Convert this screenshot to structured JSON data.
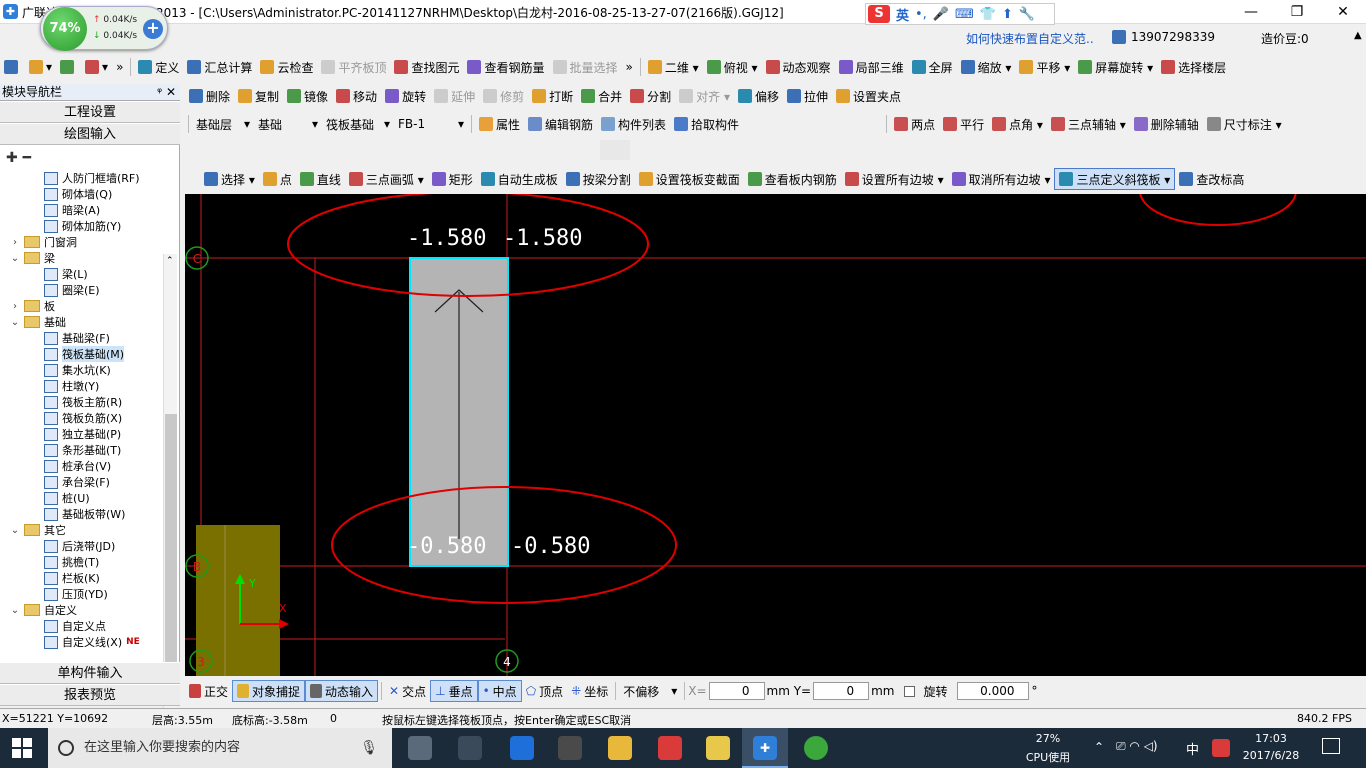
{
  "window": {
    "title": "广联达钢筋算量软件 GGJ2013 - [C:\\Users\\Administrator.PC-20141127NRHM\\Desktop\\白龙村-2016-08-25-13-27-07(2166版).GGJ12]",
    "minimize": "—",
    "restore": "❐",
    "close": "✕"
  },
  "speed_widget": {
    "percent": "74%",
    "up": "0.04K/s",
    "down": "0.04K/s",
    "plus": "+"
  },
  "ime": {
    "logo": "S",
    "lang": "英",
    "items": [
      "•,",
      "🎤",
      "⌨",
      "👕",
      "⬆",
      "🔧"
    ]
  },
  "info": {
    "help": "如何快速布置自定义范..",
    "user": "13907298339",
    "bean": "造价豆:0"
  },
  "toolbar1": [
    {
      "label": "",
      "icon": "new-file-icon"
    },
    {
      "label": "▾",
      "icon": "open-folder-icon"
    },
    {
      "label": "",
      "icon": "save-icon"
    },
    {
      "label": "▾",
      "icon": "undo-icon"
    },
    {
      "label": "»",
      "icon": ""
    },
    {
      "label": "定义",
      "icon": "define-icon"
    },
    {
      "label": "汇总计算",
      "icon": "sigma-icon"
    },
    {
      "label": "云检查",
      "icon": "cloud-check-icon"
    },
    {
      "label": "平齐板顶",
      "icon": "align-icon",
      "disabled": true
    },
    {
      "label": "查找图元",
      "icon": "binoculars-icon"
    },
    {
      "label": "查看钢筋量",
      "icon": "rebar-view-icon"
    },
    {
      "label": "批量选择",
      "icon": "batch-select-icon",
      "disabled": true
    },
    {
      "label": "»",
      "icon": ""
    },
    {
      "label": "二维 ▾",
      "icon": "2d-icon"
    },
    {
      "label": "俯视 ▾",
      "icon": "top-view-icon"
    },
    {
      "label": "动态观察",
      "icon": "orbit-icon"
    },
    {
      "label": "局部三维",
      "icon": "local-3d-icon"
    },
    {
      "label": "全屏",
      "icon": "fullscreen-icon"
    },
    {
      "label": "缩放 ▾",
      "icon": "zoom-icon"
    },
    {
      "label": "平移 ▾",
      "icon": "pan-icon"
    },
    {
      "label": "屏幕旋转 ▾",
      "icon": "rotate-screen-icon"
    },
    {
      "label": "选择楼层",
      "icon": "floor-select-icon"
    }
  ],
  "toolbar2": [
    {
      "label": "删除",
      "icon": "delete-icon"
    },
    {
      "label": "复制",
      "icon": "copy-icon"
    },
    {
      "label": "镜像",
      "icon": "mirror-icon"
    },
    {
      "label": "移动",
      "icon": "move-icon"
    },
    {
      "label": "旋转",
      "icon": "rotate-icon"
    },
    {
      "label": "延伸",
      "icon": "extend-icon",
      "disabled": true
    },
    {
      "label": "修剪",
      "icon": "trim-icon",
      "disabled": true
    },
    {
      "label": "打断",
      "icon": "break-icon"
    },
    {
      "label": "合并",
      "icon": "merge-icon"
    },
    {
      "label": "分割",
      "icon": "split-icon"
    },
    {
      "label": "对齐 ▾",
      "icon": "align2-icon",
      "disabled": true
    },
    {
      "label": "偏移",
      "icon": "offset-icon"
    },
    {
      "label": "拉伸",
      "icon": "stretch-icon"
    },
    {
      "label": "设置夹点",
      "icon": "grip-icon"
    }
  ],
  "toolbar3": {
    "layer": "基础层",
    "category": "基础",
    "component_type": "筏板基础",
    "component": "FB-1",
    "buttons": [
      "属性",
      "编辑钢筋",
      "构件列表",
      "拾取构件"
    ],
    "right_buttons": [
      "两点",
      "平行",
      "点角 ▾",
      "三点辅轴 ▾",
      "删除辅轴",
      "尺寸标注 ▾"
    ]
  },
  "toolbar4": [
    {
      "label": "选择 ▾",
      "icon": "cursor-icon"
    },
    {
      "label": "点",
      "icon": "point-icon"
    },
    {
      "label": "直线",
      "icon": "line-icon"
    },
    {
      "label": "三点画弧 ▾",
      "icon": "arc-icon"
    },
    {
      "label": "矩形",
      "icon": "rectangle-icon"
    },
    {
      "label": "自动生成板",
      "icon": "auto-slab-icon"
    },
    {
      "label": "按梁分割",
      "icon": "beam-split-icon"
    },
    {
      "label": "设置筏板变截面",
      "icon": "variable-section-icon"
    },
    {
      "label": "查看板内钢筋",
      "icon": "slab-rebar-icon"
    },
    {
      "label": "设置所有边坡 ▾",
      "icon": "slope-icon"
    },
    {
      "label": "取消所有边坡 ▾",
      "icon": "cancel-slope-icon"
    },
    {
      "label": "三点定义斜筏板 ▾",
      "icon": "three-point-slab-icon",
      "active": true
    },
    {
      "label": "查改标高",
      "icon": "elevation-icon"
    }
  ],
  "left_panel": {
    "header": "模块导航栏",
    "pin": "ᵠ ✕",
    "btn_engineering": "工程设置",
    "btn_drawing": "绘图输入",
    "btn_single": "单构件输入",
    "btn_report": "报表预览",
    "tree": [
      {
        "label": "人防门框墙(RF)",
        "level": 2,
        "type": "item"
      },
      {
        "label": "砌体墙(Q)",
        "level": 2,
        "type": "item"
      },
      {
        "label": "暗梁(A)",
        "level": 2,
        "type": "item"
      },
      {
        "label": "砌体加筋(Y)",
        "level": 2,
        "type": "item"
      },
      {
        "label": "门窗洞",
        "level": 1,
        "type": "folder",
        "expand": "›"
      },
      {
        "label": "梁",
        "level": 1,
        "type": "folder",
        "expand": "⌄"
      },
      {
        "label": "梁(L)",
        "level": 2,
        "type": "item"
      },
      {
        "label": "圈梁(E)",
        "level": 2,
        "type": "item"
      },
      {
        "label": "板",
        "level": 1,
        "type": "folder",
        "expand": "›"
      },
      {
        "label": "基础",
        "level": 1,
        "type": "folder",
        "expand": "⌄"
      },
      {
        "label": "基础梁(F)",
        "level": 2,
        "type": "item"
      },
      {
        "label": "筏板基础(M)",
        "level": 2,
        "type": "item",
        "selected": true
      },
      {
        "label": "集水坑(K)",
        "level": 2,
        "type": "item"
      },
      {
        "label": "柱墩(Y)",
        "level": 2,
        "type": "item"
      },
      {
        "label": "筏板主筋(R)",
        "level": 2,
        "type": "item"
      },
      {
        "label": "筏板负筋(X)",
        "level": 2,
        "type": "item"
      },
      {
        "label": "独立基础(P)",
        "level": 2,
        "type": "item"
      },
      {
        "label": "条形基础(T)",
        "level": 2,
        "type": "item"
      },
      {
        "label": "桩承台(V)",
        "level": 2,
        "type": "item"
      },
      {
        "label": "承台梁(F)",
        "level": 2,
        "type": "item"
      },
      {
        "label": "桩(U)",
        "level": 2,
        "type": "item"
      },
      {
        "label": "基础板带(W)",
        "level": 2,
        "type": "item"
      },
      {
        "label": "其它",
        "level": 1,
        "type": "folder",
        "expand": "⌄"
      },
      {
        "label": "后浇带(JD)",
        "level": 2,
        "type": "item"
      },
      {
        "label": "挑檐(T)",
        "level": 2,
        "type": "item"
      },
      {
        "label": "栏板(K)",
        "level": 2,
        "type": "item"
      },
      {
        "label": "压顶(YD)",
        "level": 2,
        "type": "item"
      },
      {
        "label": "自定义",
        "level": 1,
        "type": "folder",
        "expand": "⌄"
      },
      {
        "label": "自定义点",
        "level": 2,
        "type": "item"
      },
      {
        "label": "自定义线(X)",
        "level": 2,
        "type": "item",
        "badge": "NE"
      }
    ]
  },
  "canvas": {
    "axis_labels": [
      "C",
      "B",
      "3",
      "4"
    ],
    "elevations": [
      "-1.580",
      "-1.580",
      "-0.580",
      "-0.580"
    ],
    "ucs_y": "Y",
    "ucs_x": "X"
  },
  "snapbar": {
    "items": [
      "正交",
      "对象捕捉",
      "动态输入",
      "交点",
      "垂点",
      "中点",
      "顶点",
      "坐标"
    ],
    "offset_mode": "不偏移",
    "x_label": "X=",
    "x_value": "0",
    "y_label": "mm Y=",
    "y_value": "0",
    "mm": "mm",
    "rotate_label": "旋转",
    "rotate_value": "0.000",
    "degree": "°"
  },
  "statusbar": {
    "coords": "X=51221 Y=10692",
    "floor_height": "层高:3.55m",
    "bottom_elev": "底标高:-3.58m",
    "zero": "0",
    "hint": "按鼠标左键选择筏板顶点，按Enter确定或ESC取消",
    "fps": "840.2 FPS"
  },
  "taskbar": {
    "search_placeholder": "在这里输入你要搜索的内容",
    "cpu_pct": "27%",
    "cpu_label": "CPU使用",
    "lang": "中",
    "time": "17:03",
    "date": "2017/6/28"
  },
  "colors": {
    "annotation_red": "#e00000",
    "slab_fill": "#b4b4b4",
    "slab_border": "#00e8ff",
    "grid_red": "#c81e1e",
    "grid_green": "#1e9a1e",
    "olive": "#7a7000"
  }
}
